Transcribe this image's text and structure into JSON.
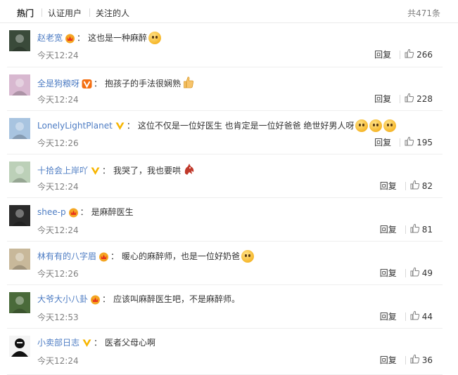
{
  "tabs": [
    {
      "label": "热门"
    },
    {
      "label": "认证用户"
    },
    {
      "label": "关注的人"
    }
  ],
  "total": "共471条",
  "reply_label": "回复",
  "comments": [
    {
      "name": "赵老宽",
      "badge": "crown-badge",
      "text": "这也是一种麻醉",
      "emoji": "smile",
      "time": "今天12:24",
      "likes": "266",
      "avatar_color": "#3a4a3a"
    },
    {
      "name": "全是狗粮呀",
      "badge": "v-badge-orange",
      "text": "抱孩子的手法很娴熟",
      "emoji": "thumb",
      "time": "今天12:24",
      "likes": "228",
      "avatar_color": "#d8b8d0"
    },
    {
      "name": "LonelyLightPlanet",
      "badge": "v-badge-gold",
      "text": "这位不仅是一位好医生 也肯定是一位好爸爸 绝世好男人呀",
      "emoji": "tears",
      "time": "今天12:26",
      "likes": "195",
      "avatar_color": "#a8c4e0"
    },
    {
      "name": "十拾会上岸吖",
      "badge": "v-badge-gold",
      "text": "我哭了，我也要哄",
      "emoji": "dragon",
      "time": "今天12:24",
      "likes": "82",
      "avatar_color": "#bcd0b8"
    },
    {
      "name": "shee-p",
      "badge": "crown-badge",
      "text": "是麻醉医生",
      "emoji": "",
      "time": "今天12:24",
      "likes": "81",
      "avatar_color": "#2a2a2a"
    },
    {
      "name": "林有有的八字眉",
      "badge": "crown-badge",
      "text": "暖心的麻醉师，也是一位好奶爸",
      "emoji": "laugh",
      "time": "今天12:26",
      "likes": "49",
      "avatar_color": "#c8b89a"
    },
    {
      "name": "大爷大小八卦",
      "badge": "crown-badge",
      "text": "应该叫麻醉医生吧，不是麻醉师。",
      "emoji": "",
      "time": "今天12:53",
      "likes": "44",
      "avatar_color": "#4a6a3a"
    },
    {
      "name": "小卖部日志",
      "badge": "v-badge-gold",
      "text": "医者父母心啊",
      "emoji": "",
      "time": "今天12:24",
      "likes": "36",
      "avatar_color": "#f0f0f0"
    }
  ],
  "colors": {
    "link": "#4d7cc3",
    "meta": "#808080",
    "badge_gold": "#f7b500",
    "badge_orange": "#f46f12"
  }
}
